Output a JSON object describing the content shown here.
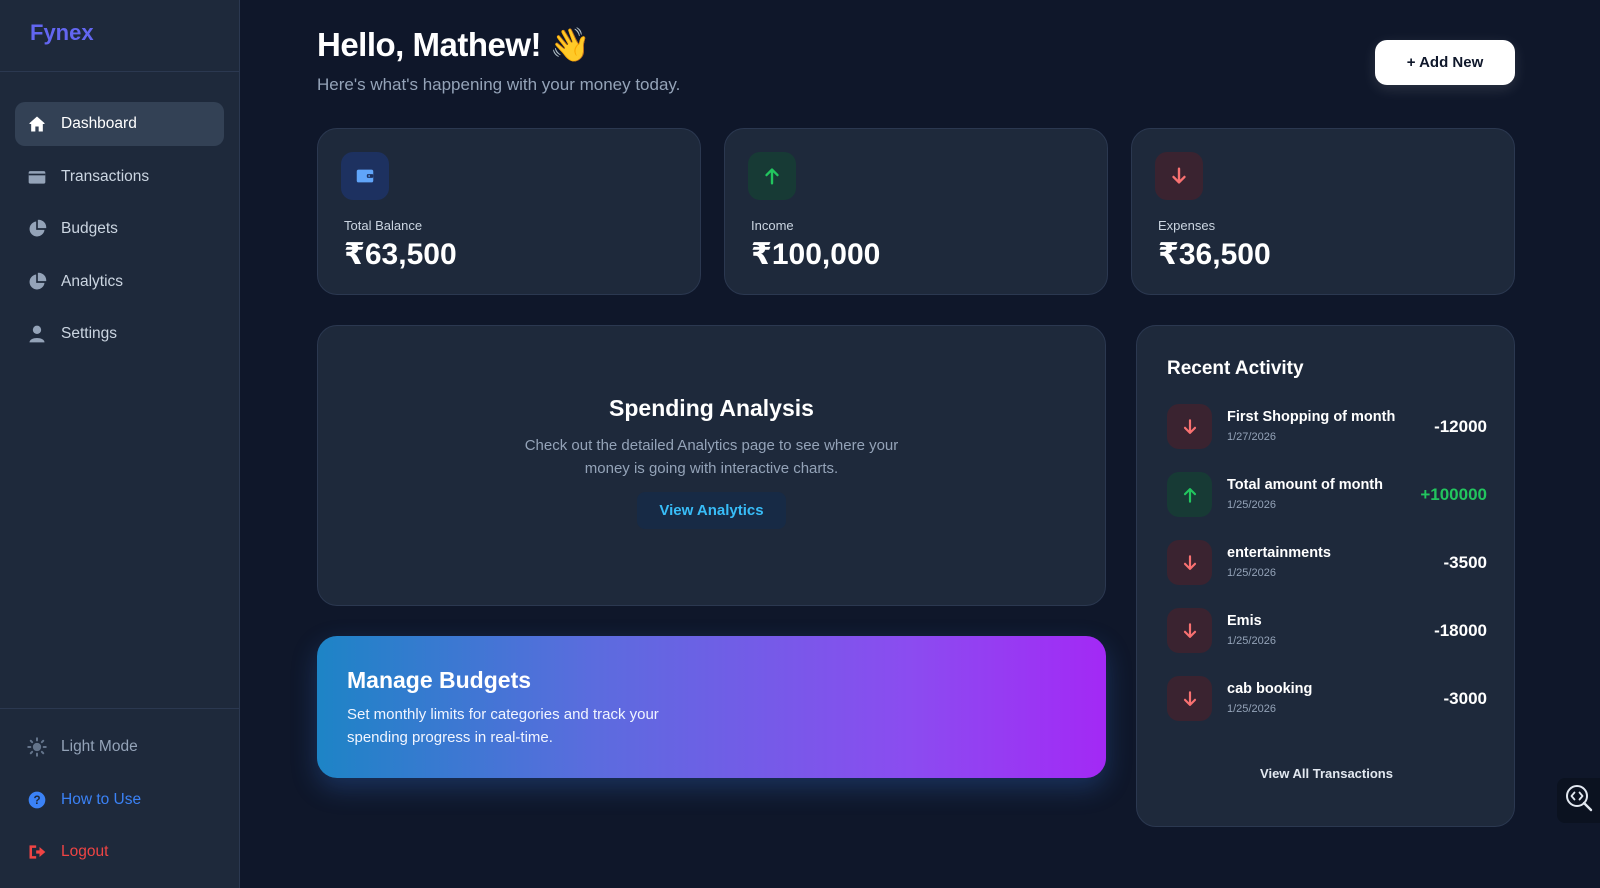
{
  "sidebar": {
    "brand": "Fynex",
    "nav": [
      {
        "label": "Dashboard",
        "icon": "home-icon",
        "active": true
      },
      {
        "label": "Transactions",
        "icon": "wallet-icon",
        "active": false
      },
      {
        "label": "Budgets",
        "icon": "pie-chart-icon",
        "active": false
      },
      {
        "label": "Analytics",
        "icon": "pie-chart-icon",
        "active": false
      },
      {
        "label": "Settings",
        "icon": "user-icon",
        "active": false
      }
    ],
    "bottom": {
      "light_mode": "Light Mode",
      "how_to_use": "How to Use",
      "logout": "Logout"
    }
  },
  "header": {
    "greeting": "Hello, Mathew! 👋",
    "subtitle": "Here's what's happening with your money today.",
    "add_button": "+ Add New"
  },
  "stats": [
    {
      "label": "Total Balance",
      "value": "₹63,500",
      "icon": "wallet-icon",
      "color": "#3b82f6"
    },
    {
      "label": "Income",
      "value": "₹100,000",
      "icon": "arrow-up-icon",
      "color": "#22c55e"
    },
    {
      "label": "Expenses",
      "value": "₹36,500",
      "icon": "arrow-down-icon",
      "color": "#ef4444"
    }
  ],
  "analysis": {
    "title": "Spending Analysis",
    "description": "Check out the detailed Analytics page to see where your money is going with interactive charts.",
    "button": "View Analytics"
  },
  "budgets": {
    "title": "Manage Budgets",
    "description": "Set monthly limits for categories and track your spending progress in real-time."
  },
  "activity": {
    "title": "Recent Activity",
    "items": [
      {
        "name": "First Shopping of month",
        "date": "1/27/2026",
        "amount": "-12000",
        "type": "down"
      },
      {
        "name": "Total amount of month",
        "date": "1/25/2026",
        "amount": "+100000",
        "type": "up"
      },
      {
        "name": "entertainments",
        "date": "1/25/2026",
        "amount": "-3500",
        "type": "down"
      },
      {
        "name": "Emis",
        "date": "1/25/2026",
        "amount": "-18000",
        "type": "down"
      },
      {
        "name": "cab booking",
        "date": "1/25/2026",
        "amount": "-3000",
        "type": "down"
      }
    ],
    "view_all": "View All Transactions"
  },
  "colors": {
    "background": "#0f172a",
    "card": "#1e293b",
    "accent_blue": "#3b82f6",
    "positive": "#22c55e",
    "negative": "#ef4444"
  }
}
